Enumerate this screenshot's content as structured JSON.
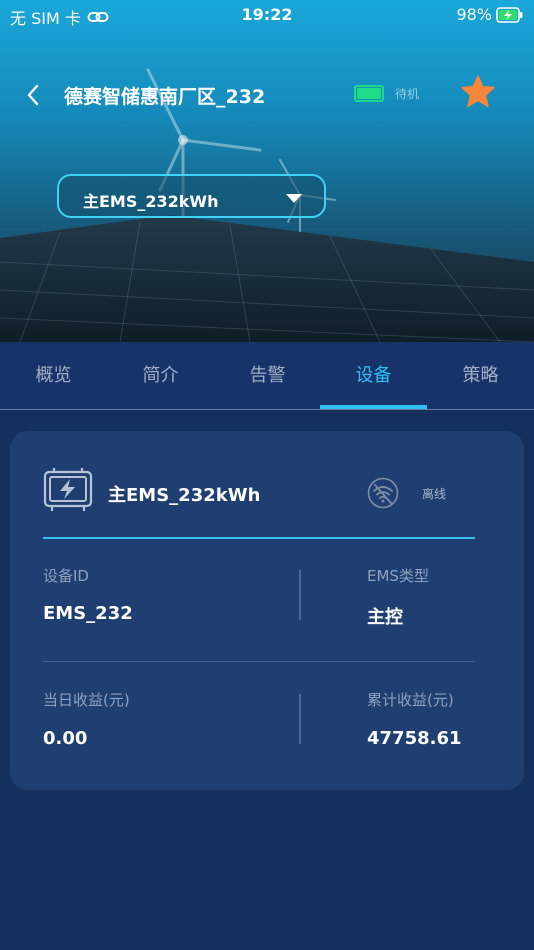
{
  "status_bar": {
    "carrier": "无 SIM 卡",
    "time": "19:22",
    "battery_percent": "98%"
  },
  "header": {
    "title": "德赛智储惠南厂区_232",
    "state": "待机"
  },
  "selector": {
    "selected": "主EMS_232kWh"
  },
  "tabs": [
    {
      "label": "概览"
    },
    {
      "label": "简介"
    },
    {
      "label": "告警"
    },
    {
      "label": "设备"
    },
    {
      "label": "策略"
    }
  ],
  "active_tab": "设备",
  "device": {
    "name": "主EMS_232kWh",
    "connection": "离线",
    "fields": {
      "device_id": {
        "label": "设备ID",
        "value": "EMS_232"
      },
      "ems_type": {
        "label": "EMS类型",
        "value": "主控"
      },
      "daily_income": {
        "label": "当日收益(元)",
        "value": "0.00"
      },
      "total_income": {
        "label": "累计收益(元)",
        "value": "47758.61"
      }
    }
  },
  "colors": {
    "accent": "#2fc1f5",
    "battery_ok": "#1edb86",
    "star": "#f6863a",
    "background": "#16305e",
    "card": "#1f3f73"
  },
  "icons": {
    "back": "chevron-left-icon",
    "battery": "battery-icon",
    "favorite": "star-icon",
    "device": "battery-charging-icon",
    "connection": "wifi-off-icon"
  }
}
